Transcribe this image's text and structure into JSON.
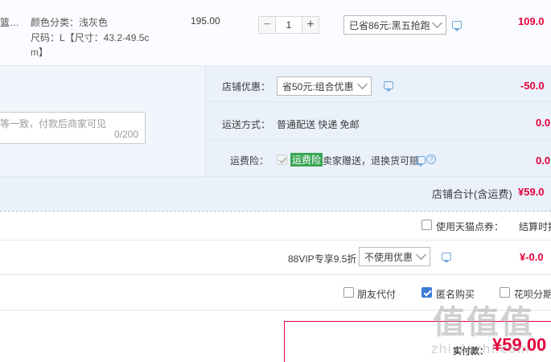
{
  "item": {
    "name_fragment": "篮…",
    "spec_color_label": "颜色分类：",
    "spec_color_value": "浅灰色",
    "spec_size_line1": "尺码：L【尺寸：43.2-49.5c",
    "spec_size_line2": "m】",
    "unit_price": "195.00",
    "quantity": "1",
    "discount_select": "已省86元:黑五抢跑",
    "subtotal": "109.0"
  },
  "store": {
    "note_placeholder": "等一致，付款后商家可见",
    "note_counter": "0/200",
    "coupon_label": "店铺优惠：",
    "coupon_select": "省50元:组合优惠",
    "coupon_amount": "-50.0",
    "shipping_label": "运送方式：",
    "shipping_value": "普通配送 快递 免邮",
    "shipping_amount": "0.0",
    "insurance_label": "运费险：",
    "insurance_badge": "运费险",
    "insurance_text": "卖家赠送，退换货可赔",
    "insurance_amount": "0.0",
    "total_label": "店铺合计(含运费)",
    "total_amount": "¥59.0"
  },
  "tmall_points": {
    "label": "使用天猫点券：",
    "right_text": "结算时扣"
  },
  "vip": {
    "label": "88VIP专享9.5折",
    "select": "不使用优惠",
    "amount": "¥-0.0"
  },
  "options": {
    "friend_pay": "朋友代付",
    "anonymous": "匿名购买",
    "huabei": "花呗分期"
  },
  "payment": {
    "label": "实付款：",
    "amount": "¥59.00"
  },
  "watermark": {
    "logo": "值值值",
    "site": "zhi.dezhi.com"
  },
  "colors": {
    "accent_red": "#e4003a",
    "link_blue": "#3a7bd5",
    "insurance_green": "#3aa655"
  }
}
